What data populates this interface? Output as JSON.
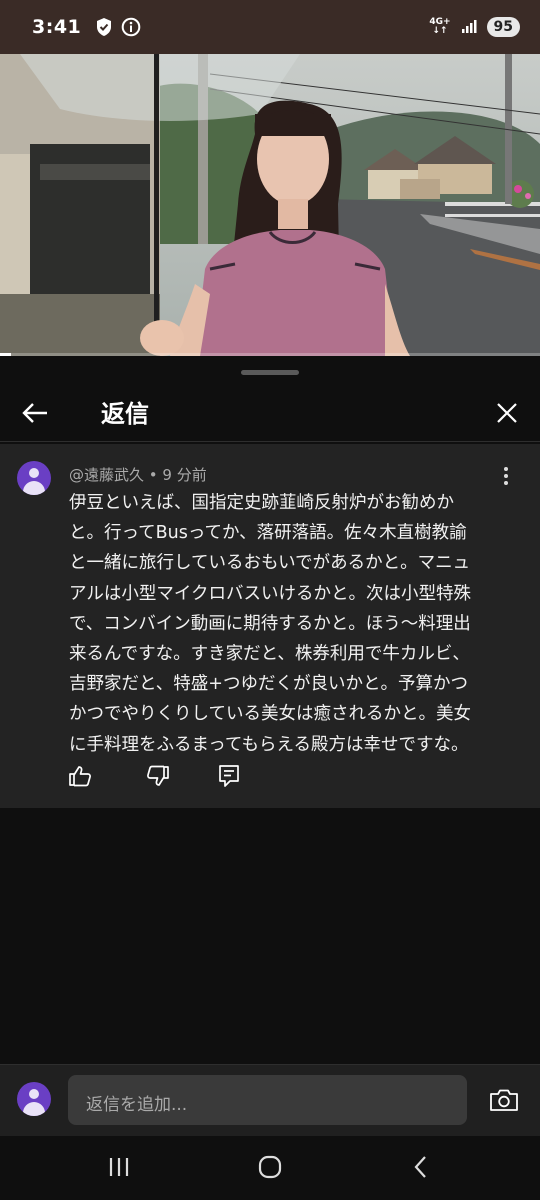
{
  "status_bar": {
    "time": "3:41",
    "network_label_top": "4G+",
    "battery": "95"
  },
  "video": {
    "progress": 0.02
  },
  "sheet": {
    "title": "返信"
  },
  "comment": {
    "author": "@遠藤武久",
    "time_ago": "9 分前",
    "text": "伊豆といえば、国指定史跡韮崎反射炉がお勧めか\nと。行ってBusってか、落研落語。佐々木直樹教諭\nと一緒に旅行しているおもいでがあるかと。マニュ\nアルは小型マイクロバスいけるかと。次は小型特殊\nで、コンバイン動画に期待するかと。ほう〜料理出\n来るんですな。すき家だと、株券利用で牛カルビ、\n吉野家だと、特盛+つゆだくが良いかと。予算かつ\nかつでやりくりしている美女は癒されるかと。美女\nに手料理をふるまってもらえる殿方は幸せですな。"
  },
  "reply": {
    "placeholder": "返信を追加..."
  },
  "colors": {
    "status_bar": "#3a2b26",
    "background": "#0f0f0f",
    "card": "#232323",
    "avatar": "#6a3fc4"
  },
  "icons": [
    "shield-check-icon",
    "info-icon",
    "signal-icon",
    "back-arrow-icon",
    "close-icon",
    "more-vert-icon",
    "like-icon",
    "dislike-icon",
    "reply-icon",
    "camera-icon",
    "recents-icon",
    "home-icon",
    "back-icon"
  ]
}
